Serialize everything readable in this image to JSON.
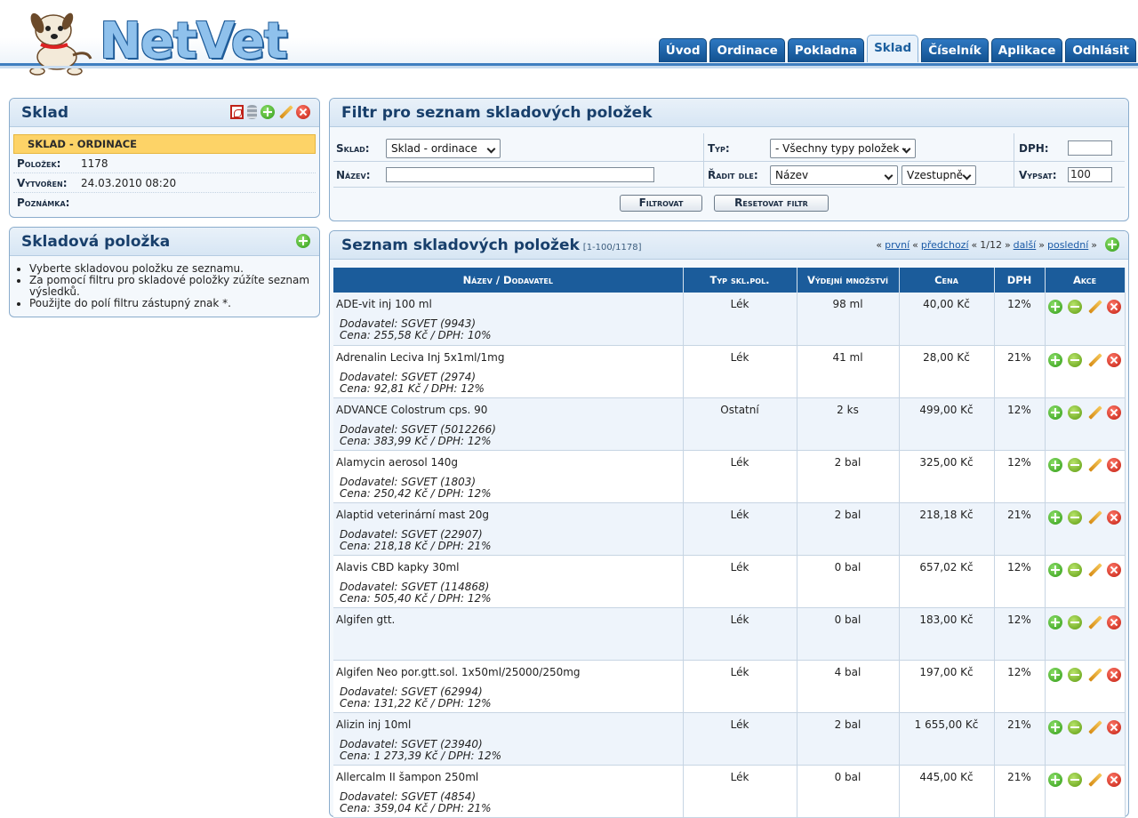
{
  "app": {
    "logo_text": "NetVet"
  },
  "tabs": [
    {
      "label": "Úvod",
      "active": false
    },
    {
      "label": "Ordinace",
      "active": false
    },
    {
      "label": "Pokladna",
      "active": false
    },
    {
      "label": "Sklad",
      "active": true
    },
    {
      "label": "Číselník",
      "active": false
    },
    {
      "label": "Aplikace",
      "active": false
    },
    {
      "label": "Odhlásit",
      "active": false
    }
  ],
  "sklad_panel": {
    "title": "Sklad",
    "band": "SKLAD - ORDINACE",
    "rows": [
      {
        "label": "Položek:",
        "value": "1178"
      },
      {
        "label": "Vytvořen:",
        "value": "24.03.2010 08:20"
      },
      {
        "label": "Poznámka:",
        "value": ""
      }
    ]
  },
  "item_panel": {
    "title": "Skladová položka",
    "hints": [
      "Vyberte skladovou položku ze seznamu.",
      "Za pomocí filtru pro skladové položky zúžíte seznam výsledků.",
      "Použijte do polí filtru zástupný znak *."
    ]
  },
  "filter": {
    "title": "Filtr pro seznam skladových položek",
    "sklad_label": "Sklad:",
    "sklad_value": "Sklad - ordinace",
    "typ_label": "Typ:",
    "typ_value": "- Všechny typy položek -",
    "dph_label": "DPH:",
    "dph_value": "",
    "nazev_label": "Název:",
    "nazev_value": "",
    "radit_label": "Řadit dle:",
    "radit_value": "Název",
    "order_value": "Vzestupně",
    "vypsat_label": "Vypsat:",
    "vypsat_value": "100",
    "btn_filter": "Filtrovat",
    "btn_reset": "Resetovat filtr"
  },
  "list": {
    "title": "Seznam skladových položek",
    "range": "[1-100/1178]",
    "pager": {
      "first": "první",
      "prev": "předchozí",
      "page": "1/12",
      "next": "další",
      "last": "poslední"
    },
    "columns": [
      "Název / Dodavatel",
      "Typ skl.pol.",
      "Výdejní množství",
      "Cena",
      "DPH",
      "Akce"
    ],
    "rows": [
      {
        "name": "ADE-vit inj 100 ml",
        "supplier": "Dodavatel: SGVET (9943)",
        "price_line": "Cena: 255,58 Kč / DPH: 10%",
        "type": "Lék",
        "qty": "98 ml",
        "price": "40,00 Kč",
        "vat": "12%"
      },
      {
        "name": "Adrenalin Leciva Inj 5x1ml/1mg",
        "supplier": "Dodavatel: SGVET (2974)",
        "price_line": "Cena: 92,81 Kč / DPH: 12%",
        "type": "Lék",
        "qty": "41 ml",
        "price": "28,00 Kč",
        "vat": "21%"
      },
      {
        "name": "ADVANCE Colostrum cps. 90",
        "supplier": "Dodavatel: SGVET (5012266)",
        "price_line": "Cena: 383,99 Kč / DPH: 12%",
        "type": "Ostatní",
        "qty": "2 ks",
        "price": "499,00 Kč",
        "vat": "12%"
      },
      {
        "name": "Alamycin aerosol 140g",
        "supplier": "Dodavatel: SGVET (1803)",
        "price_line": "Cena: 250,42 Kč / DPH: 12%",
        "type": "Lék",
        "qty": "2 bal",
        "price": "325,00 Kč",
        "vat": "12%"
      },
      {
        "name": "Alaptid veterinární mast 20g",
        "supplier": "Dodavatel: SGVET (22907)",
        "price_line": "Cena: 218,18 Kč / DPH: 21%",
        "type": "Lék",
        "qty": "2 bal",
        "price": "218,18 Kč",
        "vat": "21%"
      },
      {
        "name": "Alavis CBD kapky 30ml",
        "supplier": "Dodavatel: SGVET (114868)",
        "price_line": "Cena: 505,40 Kč / DPH: 12%",
        "type": "Lék",
        "qty": "0 bal",
        "price": "657,02 Kč",
        "vat": "12%"
      },
      {
        "name": "Algifen gtt.",
        "supplier": "",
        "price_line": "",
        "type": "Lék",
        "qty": "0 bal",
        "price": "183,00 Kč",
        "vat": "12%"
      },
      {
        "name": "Algifen Neo por.gtt.sol. 1x50ml/25000/250mg",
        "supplier": "Dodavatel: SGVET (62994)",
        "price_line": "Cena: 131,22 Kč / DPH: 12%",
        "type": "Lék",
        "qty": "4 bal",
        "price": "197,00 Kč",
        "vat": "12%"
      },
      {
        "name": "Alizin inj 10ml",
        "supplier": "Dodavatel: SGVET (23940)",
        "price_line": "Cena: 1 273,39 Kč / DPH: 12%",
        "type": "Lék",
        "qty": "2 bal",
        "price": "1 655,00 Kč",
        "vat": "21%"
      },
      {
        "name": "Allercalm II šampon 250ml",
        "supplier": "Dodavatel: SGVET (4854)",
        "price_line": "Cena: 359,04 Kč / DPH: 21%",
        "type": "Lék",
        "qty": "0 bal",
        "price": "445,00 Kč",
        "vat": "21%"
      }
    ]
  }
}
